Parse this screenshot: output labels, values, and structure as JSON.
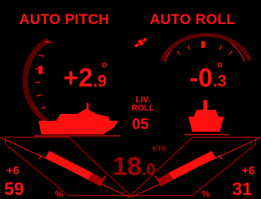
{
  "pitch": {
    "title": "AUTO PITCH",
    "int": "+2",
    "dec": ".9",
    "unit": "o"
  },
  "roll": {
    "title": "AUTO ROLL",
    "int": "-0",
    "dec": ".3",
    "unit": "o"
  },
  "liv_roll": {
    "label_line1": "LIV.",
    "label_line2": "ROLL",
    "value": "05"
  },
  "speed": {
    "unit": "KTS",
    "int": "18",
    "dec": ".0"
  },
  "left_trim": {
    "offset": "+6",
    "value": "59",
    "unit": "%"
  },
  "right_trim": {
    "offset": "+6",
    "value": "31",
    "unit": "%"
  },
  "icons": {
    "satellite": "satellite-icon",
    "boat_side": "boat-side-icon",
    "boat_rear": "boat-rear-icon"
  },
  "colors": {
    "accent": "#ff1010",
    "dim": "#7a0000",
    "background": "#000000"
  }
}
